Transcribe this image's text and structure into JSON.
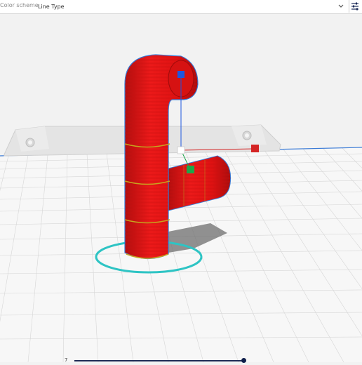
{
  "toolbar": {
    "color_scheme_label": "Color scheme",
    "color_scheme_value": "Line Type",
    "dropdown_icon": "chevron-down-icon",
    "settings_icon": "sliders-icon"
  },
  "viewport": {
    "model_color": "#e81414",
    "build_plate_color": "#f6f6f6",
    "selection_outline_color": "#2f7fe0",
    "ring_color": "#2ec4c4",
    "handle_colors": {
      "blue": "#1f57e0",
      "green": "#1ea64a",
      "red": "#d42424"
    }
  },
  "layer_slider": {
    "min_label": "7",
    "position": 1.0
  }
}
